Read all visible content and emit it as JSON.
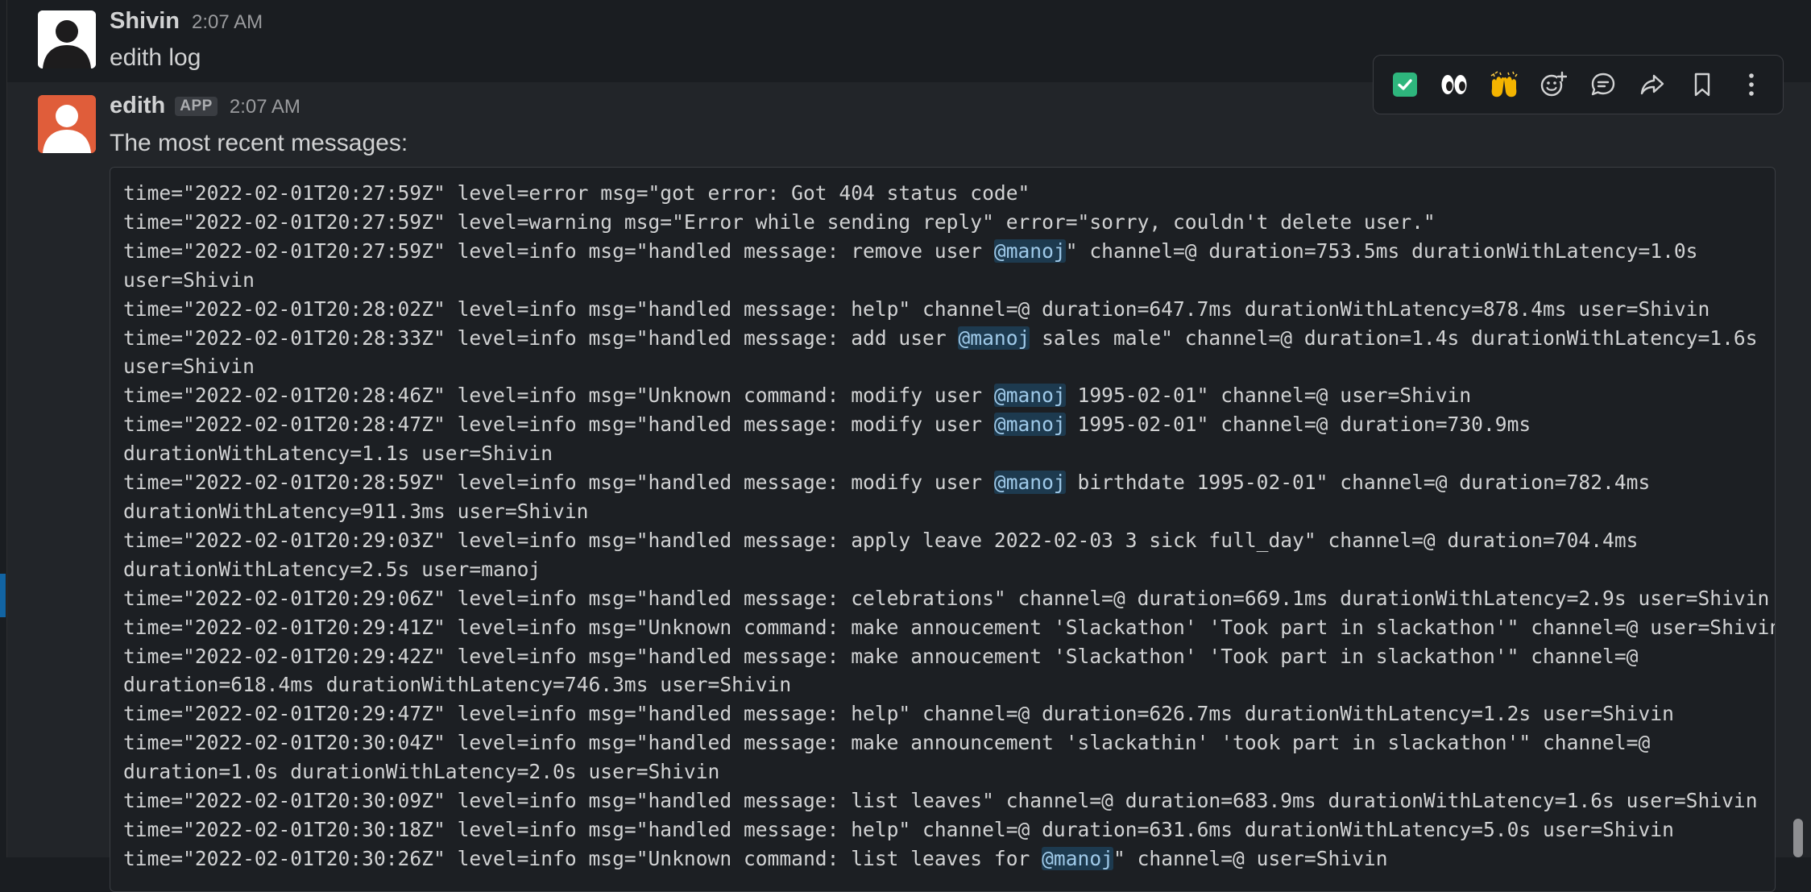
{
  "messages": [
    {
      "sender": "Shivin",
      "time": "2:07 AM",
      "text": "edith log"
    },
    {
      "sender": "edith",
      "badge": "APP",
      "time": "2:07 AM",
      "text": "The most recent messages:"
    }
  ],
  "log_lines": [
    [
      {
        "t": "time=\"2022-02-01T20:27:59Z\" level=error msg=\"got error: Got 404 status code\""
      }
    ],
    [
      {
        "t": "time=\"2022-02-01T20:27:59Z\" level=warning msg=\"Error while sending reply\" error=\"sorry, couldn't delete user.\""
      }
    ],
    [
      {
        "t": "time=\"2022-02-01T20:27:59Z\" level=info msg=\"handled message: remove user "
      },
      {
        "t": "@manoj",
        "m": true
      },
      {
        "t": "\" channel=@ duration=753.5ms durationWithLatency=1.0s"
      }
    ],
    [
      {
        "t": "user=Shivin"
      }
    ],
    [
      {
        "t": "time=\"2022-02-01T20:28:02Z\" level=info msg=\"handled message: help\" channel=@ duration=647.7ms durationWithLatency=878.4ms user=Shivin"
      }
    ],
    [
      {
        "t": "time=\"2022-02-01T20:28:33Z\" level=info msg=\"handled message: add user "
      },
      {
        "t": "@manoj",
        "m": true
      },
      {
        "t": " sales male\" channel=@ duration=1.4s durationWithLatency=1.6s"
      }
    ],
    [
      {
        "t": "user=Shivin"
      }
    ],
    [
      {
        "t": "time=\"2022-02-01T20:28:46Z\" level=info msg=\"Unknown command: modify user "
      },
      {
        "t": "@manoj",
        "m": true
      },
      {
        "t": " 1995-02-01\" channel=@ user=Shivin"
      }
    ],
    [
      {
        "t": "time=\"2022-02-01T20:28:47Z\" level=info msg=\"handled message: modify user "
      },
      {
        "t": "@manoj",
        "m": true
      },
      {
        "t": " 1995-02-01\" channel=@ duration=730.9ms"
      }
    ],
    [
      {
        "t": "durationWithLatency=1.1s user=Shivin"
      }
    ],
    [
      {
        "t": "time=\"2022-02-01T20:28:59Z\" level=info msg=\"handled message: modify user "
      },
      {
        "t": "@manoj",
        "m": true
      },
      {
        "t": " birthdate 1995-02-01\" channel=@ duration=782.4ms"
      }
    ],
    [
      {
        "t": "durationWithLatency=911.3ms user=Shivin"
      }
    ],
    [
      {
        "t": "time=\"2022-02-01T20:29:03Z\" level=info msg=\"handled message: apply leave 2022-02-03 3 sick full_day\" channel=@ duration=704.4ms"
      }
    ],
    [
      {
        "t": "durationWithLatency=2.5s user=manoj"
      }
    ],
    [
      {
        "t": "time=\"2022-02-01T20:29:06Z\" level=info msg=\"handled message: celebrations\" channel=@ duration=669.1ms durationWithLatency=2.9s user=Shivin"
      }
    ],
    [
      {
        "t": "time=\"2022-02-01T20:29:41Z\" level=info msg=\"Unknown command: make annoucement 'Slackathon' 'Took part in slackathon'\" channel=@ user=Shivin"
      }
    ],
    [
      {
        "t": "time=\"2022-02-01T20:29:42Z\" level=info msg=\"handled message: make annoucement 'Slackathon' 'Took part in slackathon'\" channel=@"
      }
    ],
    [
      {
        "t": "duration=618.4ms durationWithLatency=746.3ms user=Shivin"
      }
    ],
    [
      {
        "t": "time=\"2022-02-01T20:29:47Z\" level=info msg=\"handled message: help\" channel=@ duration=626.7ms durationWithLatency=1.2s user=Shivin"
      }
    ],
    [
      {
        "t": "time=\"2022-02-01T20:30:04Z\" level=info msg=\"handled message: make announcement 'slackathin' 'took part in slackathon'\" channel=@"
      }
    ],
    [
      {
        "t": "duration=1.0s durationWithLatency=2.0s user=Shivin"
      }
    ],
    [
      {
        "t": "time=\"2022-02-01T20:30:09Z\" level=info msg=\"handled message: list leaves\" channel=@ duration=683.9ms durationWithLatency=1.6s user=Shivin"
      }
    ],
    [
      {
        "t": "time=\"2022-02-01T20:30:18Z\" level=info msg=\"handled message: help\" channel=@ duration=631.6ms durationWithLatency=5.0s user=Shivin"
      }
    ],
    [
      {
        "t": "time=\"2022-02-01T20:30:26Z\" level=info msg=\"Unknown command: list leaves for "
      },
      {
        "t": "@manoj",
        "m": true
      },
      {
        "t": "\" channel=@ user=Shivin"
      }
    ]
  ],
  "toolbar": {
    "items": [
      {
        "name": "react-check-emoji",
        "icon": "check-emoji-icon"
      },
      {
        "name": "react-eyes-emoji",
        "icon": "eyes-emoji-icon"
      },
      {
        "name": "react-raised-hands-emoji",
        "icon": "raised-hands-emoji-icon"
      },
      {
        "name": "add-reaction-button",
        "icon": "add-reaction-icon"
      },
      {
        "name": "reply-in-thread-button",
        "icon": "thread-icon"
      },
      {
        "name": "share-message-button",
        "icon": "share-icon"
      },
      {
        "name": "save-message-button",
        "icon": "bookmark-icon"
      },
      {
        "name": "more-actions-button",
        "icon": "more-vertical-icon"
      }
    ]
  },
  "colors": {
    "background": "#1a1d21",
    "hover_background": "#222529",
    "text": "#d1d2d3",
    "muted": "#9a9b9e",
    "mention_bg": "#1d3a4f",
    "mention_text": "#9fc9e8",
    "bot_avatar": "#e05d3a",
    "check_green": "#2eb67d",
    "rail_accent": "#1264a3"
  }
}
